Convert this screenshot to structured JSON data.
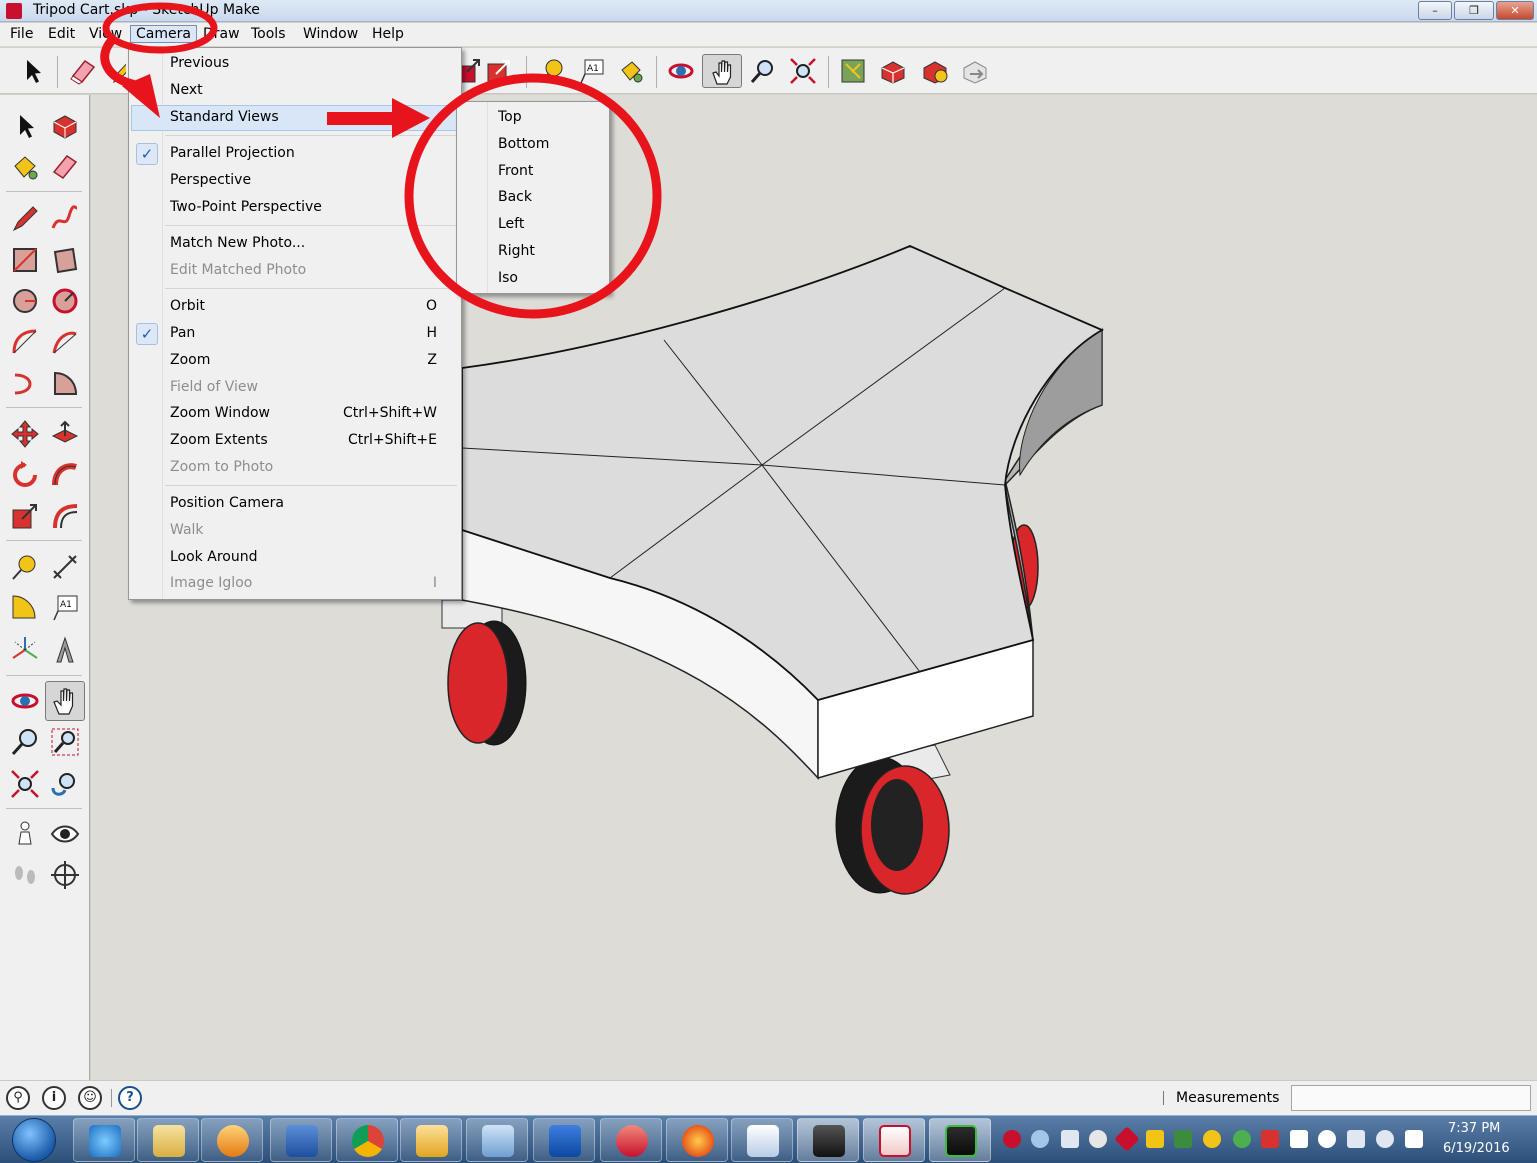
{
  "window": {
    "title": "Tripod Cart.skp - SketchUp Make",
    "min_label": "–",
    "max_label": "❐",
    "close_label": "✕"
  },
  "menubar": {
    "items": [
      "File",
      "Edit",
      "View",
      "Camera",
      "Draw",
      "Tools",
      "Window",
      "Help"
    ]
  },
  "camera_menu": {
    "items": [
      {
        "label": "Previous",
        "shortcut": "",
        "enabled": true,
        "checked": false
      },
      {
        "label": "Next",
        "shortcut": "",
        "enabled": true,
        "checked": false
      },
      {
        "label": "Standard Views",
        "shortcut": "",
        "enabled": true,
        "checked": false,
        "submenu": true
      },
      {
        "label": "Parallel Projection",
        "shortcut": "",
        "enabled": true,
        "checked": true
      },
      {
        "label": "Perspective",
        "shortcut": "",
        "enabled": true,
        "checked": false
      },
      {
        "label": "Two-Point Perspective",
        "shortcut": "",
        "enabled": true,
        "checked": false
      },
      {
        "label": "Match New Photo...",
        "shortcut": "",
        "enabled": true,
        "checked": false
      },
      {
        "label": "Edit Matched Photo",
        "shortcut": "",
        "enabled": false,
        "checked": false
      },
      {
        "label": "Orbit",
        "shortcut": "O",
        "enabled": true,
        "checked": false
      },
      {
        "label": "Pan",
        "shortcut": "H",
        "enabled": true,
        "checked": true
      },
      {
        "label": "Zoom",
        "shortcut": "Z",
        "enabled": true,
        "checked": false
      },
      {
        "label": "Field of View",
        "shortcut": "",
        "enabled": false,
        "checked": false
      },
      {
        "label": "Zoom Window",
        "shortcut": "Ctrl+Shift+W",
        "enabled": true,
        "checked": false
      },
      {
        "label": "Zoom Extents",
        "shortcut": "Ctrl+Shift+E",
        "enabled": true,
        "checked": false
      },
      {
        "label": "Zoom to Photo",
        "shortcut": "",
        "enabled": false,
        "checked": false
      },
      {
        "label": "Position Camera",
        "shortcut": "",
        "enabled": true,
        "checked": false
      },
      {
        "label": "Walk",
        "shortcut": "",
        "enabled": false,
        "checked": false
      },
      {
        "label": "Look Around",
        "shortcut": "",
        "enabled": true,
        "checked": false
      },
      {
        "label": "Image Igloo",
        "shortcut": "I",
        "enabled": false,
        "checked": false
      }
    ],
    "check_glyph": "✓"
  },
  "standard_views_submenu": {
    "items": [
      "Top",
      "Bottom",
      "Front",
      "Back",
      "Left",
      "Right",
      "Iso"
    ]
  },
  "statusbar": {
    "icons": [
      "geo-location-icon",
      "credits-icon",
      "account-icon",
      "help-icon"
    ],
    "icon_glyphs": [
      "⚲",
      "i",
      "☺",
      "?"
    ],
    "measurements_label": "Measurements",
    "measurements_value": ""
  },
  "taskbar": {
    "apps": [
      "internet-explorer",
      "file-explorer",
      "media-player",
      "word",
      "chrome",
      "outlook",
      "remote-desktop",
      "malwarebytes",
      "ccleaner",
      "firefox",
      "wordpad",
      "photo-viewer",
      "sketchup",
      "terminal"
    ],
    "time": "7:37 PM",
    "date": "6/19/2016"
  },
  "colors": {
    "annotation_red": "#e8141c",
    "menu_highlight": "#d9e6f7",
    "wheel_red": "#d8262b",
    "model_top": "#dcdcdc",
    "viewport_bg": "#dedcd6"
  }
}
